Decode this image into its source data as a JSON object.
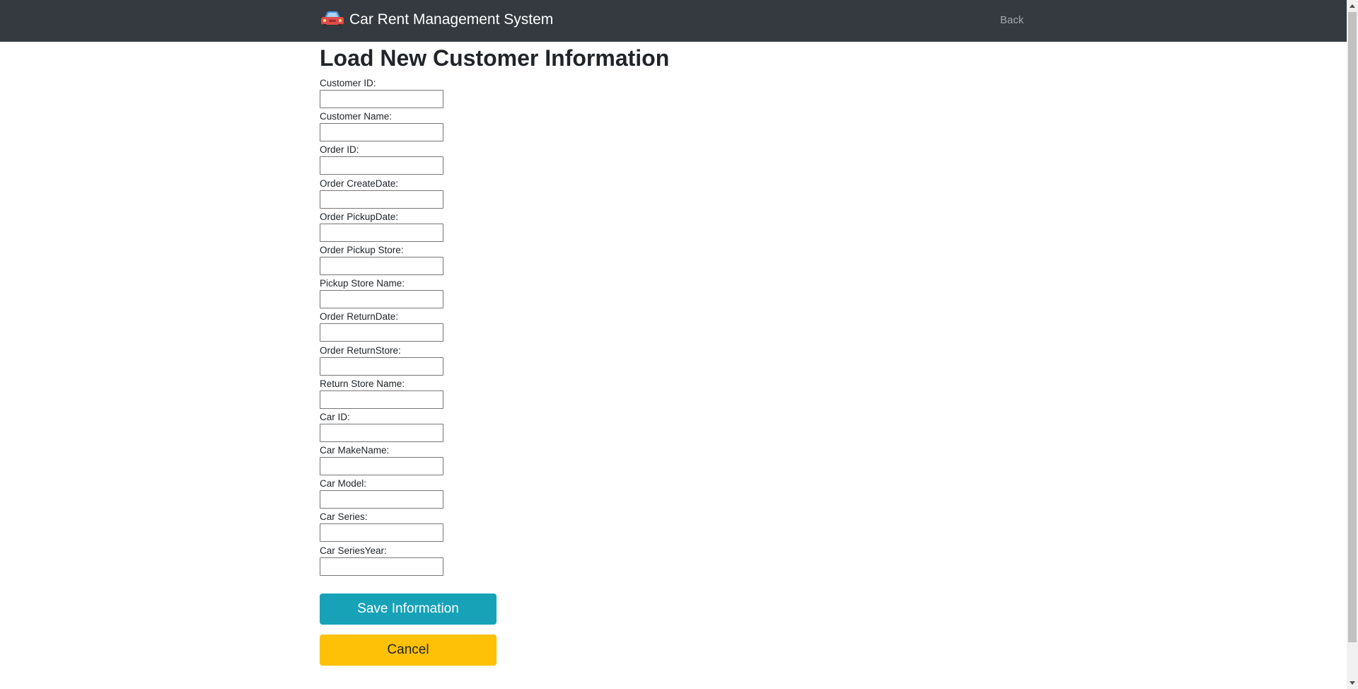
{
  "app": {
    "brand_title": "Car Rent Management System",
    "back_label": "Back"
  },
  "page": {
    "title": "Load New Customer Information"
  },
  "form": {
    "fields": [
      {
        "label": "Customer ID:",
        "value": ""
      },
      {
        "label": "Customer Name:",
        "value": ""
      },
      {
        "label": "Order ID:",
        "value": ""
      },
      {
        "label": "Order CreateDate:",
        "value": ""
      },
      {
        "label": "Order PickupDate:",
        "value": ""
      },
      {
        "label": "Order Pickup Store:",
        "value": ""
      },
      {
        "label": "Pickup Store Name:",
        "value": ""
      },
      {
        "label": "Order ReturnDate:",
        "value": ""
      },
      {
        "label": "Order ReturnStore:",
        "value": ""
      },
      {
        "label": "Return Store Name:",
        "value": ""
      },
      {
        "label": "Car ID:",
        "value": ""
      },
      {
        "label": "Car MakeName:",
        "value": ""
      },
      {
        "label": "Car Model:",
        "value": ""
      },
      {
        "label": "Car Series:",
        "value": ""
      },
      {
        "label": "Car SeriesYear:",
        "value": ""
      }
    ],
    "save_label": "Save Information",
    "cancel_label": "Cancel"
  },
  "icons": {
    "brand": "car-icon"
  },
  "colors": {
    "navbar": "#343a40",
    "save_button": "#17a2b8",
    "cancel_button": "#ffc107"
  }
}
